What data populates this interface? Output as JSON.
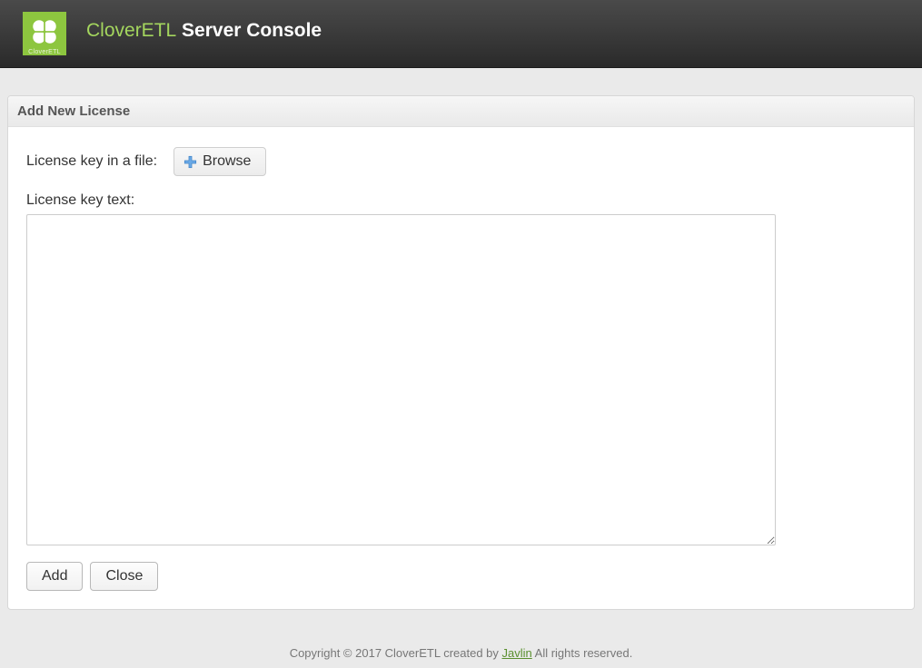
{
  "header": {
    "brand": "CloverETL",
    "title_rest": " Server Console",
    "logo_caption": "CloverETL"
  },
  "panel": {
    "title": "Add New License",
    "file_label": "License key in a file:",
    "browse_label": "Browse",
    "text_label": "License key text:",
    "textarea_value": ""
  },
  "buttons": {
    "add": "Add",
    "close": "Close"
  },
  "footer": {
    "prefix": "Copyright © 2017 CloverETL created by ",
    "link_text": "Javlin",
    "suffix": " All rights reserved."
  }
}
